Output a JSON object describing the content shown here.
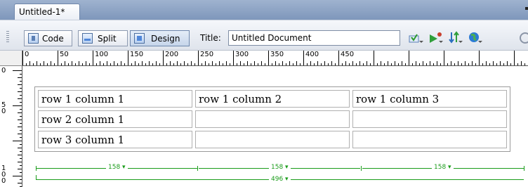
{
  "document": {
    "tab_label": "Untitled-1*"
  },
  "toolbar": {
    "code_label": "Code",
    "split_label": "Split",
    "design_label": "Design",
    "title_label": "Title:",
    "title_value": "Untitled Document",
    "icons": [
      "validate-markup-icon",
      "live-data-icon",
      "file-management-icon",
      "preview-browser-icon"
    ]
  },
  "rulers": {
    "horizontal_marks": [
      "0",
      "50",
      "100",
      "150",
      "200",
      "250",
      "300",
      "350",
      "400",
      "450"
    ],
    "vertical_marks": [
      "0",
      "50",
      "100"
    ]
  },
  "table": {
    "rows": [
      [
        "row 1 column 1",
        "row 1 column 2",
        "row 1 column 3"
      ],
      [
        "row 2 column 1",
        "",
        ""
      ],
      [
        "row 3 column 1",
        "",
        ""
      ]
    ],
    "column_widths": [
      "158",
      "158",
      "158"
    ],
    "table_width": "496"
  },
  "colors": {
    "measure_green": "#1a9c1a",
    "tabbar_blue": "#8aa3c6"
  }
}
